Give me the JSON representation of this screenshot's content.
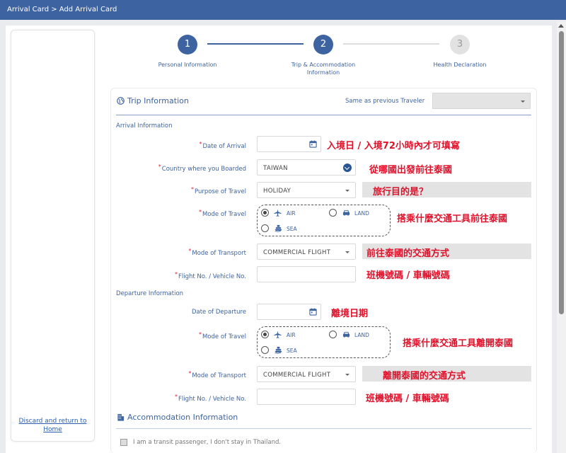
{
  "breadcrumb": "Arrival Card > Add Arrival Card",
  "steps": [
    {
      "number": "1",
      "label": "Personal Information",
      "state": "active"
    },
    {
      "number": "2",
      "label_line1": "Trip & Accommodation",
      "label_line2": "Information",
      "state": "active"
    },
    {
      "number": "3",
      "label": "Health Declaration",
      "state": "inactive"
    }
  ],
  "sidebar": {
    "discard_line1": "Discard and return to",
    "discard_line2": "Home"
  },
  "trip": {
    "title": "Trip Information",
    "same_as_previous_label": "Same as previous Traveler",
    "same_as_previous_value": ""
  },
  "arrival": {
    "heading": "Arrival Information",
    "date_label": "Date of Arrival",
    "date_value": "",
    "date_note": "入境日 / 入境72小時內才可填寫",
    "country_label": "Country where you Boarded",
    "country_value": "TAIWAN",
    "country_note": "從哪國出發前往泰國",
    "purpose_label": "Purpose of Travel",
    "purpose_value": "HOLIDAY",
    "purpose_note": "旅行目的是？",
    "mode_travel_label": "Mode of Travel",
    "mode_options": {
      "air": "AIR",
      "land": "LAND",
      "sea": "SEA",
      "selected": "AIR"
    },
    "mode_travel_note": "搭乘什麼交通工具前往泰國",
    "mode_transport_label": "Mode of Transport",
    "mode_transport_value": "COMMERCIAL FLIGHT",
    "mode_transport_note": "前往泰國的交通方式",
    "flight_label": "Flight No. / Vehicle No.",
    "flight_value": "",
    "flight_note": "班機號碼 / 車輛號碼"
  },
  "departure": {
    "heading": "Departure Information",
    "date_label": "Date of Departure",
    "date_value": "",
    "date_note": "離境日期",
    "mode_travel_label": "Mode of Travel",
    "mode_options": {
      "air": "AIR",
      "land": "LAND",
      "sea": "SEA",
      "selected": "AIR"
    },
    "mode_travel_note": "搭乘什麼交通工具離開泰國",
    "mode_transport_label": "Mode of Transport",
    "mode_transport_value": "COMMERCIAL FLIGHT",
    "mode_transport_note": "離開泰國的交通方式",
    "flight_label": "Flight No. / Vehicle No.",
    "flight_value": "",
    "flight_note": "班機號碼 / 車輛號碼"
  },
  "accommodation": {
    "title": "Accommodation Information",
    "transit_label": "I am a transit passenger, I don't stay in Thailand.",
    "transit_checked": false
  },
  "colors": {
    "brand": "#3d63a0",
    "annotation": "#e0112b",
    "required": "#d9243c"
  },
  "icons": [
    "globe-icon",
    "calendar-icon",
    "plane-icon",
    "car-icon",
    "ship-icon",
    "building-icon",
    "chevron-down-icon"
  ]
}
